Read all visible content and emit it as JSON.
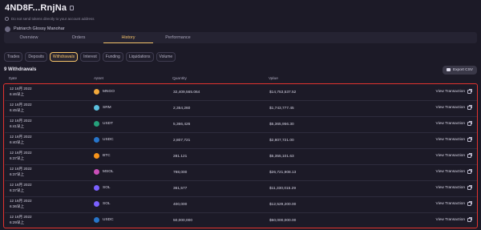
{
  "header": {
    "title": "4ND8F...RnjNa",
    "warning": "Do not send tokens directly to your account address",
    "profile_name": "Patriarch Glossy Manohar"
  },
  "tabs": [
    {
      "label": "Overview",
      "active": false
    },
    {
      "label": "Orders",
      "active": false
    },
    {
      "label": "History",
      "active": true
    },
    {
      "label": "Performance",
      "active": false
    }
  ],
  "filters": [
    {
      "label": "Trades",
      "active": false
    },
    {
      "label": "Deposits",
      "active": false
    },
    {
      "label": "Withdrawals",
      "active": true
    },
    {
      "label": "Interest",
      "active": false
    },
    {
      "label": "Funding",
      "active": false
    },
    {
      "label": "Liquidations",
      "active": false
    },
    {
      "label": "Volume",
      "active": false
    }
  ],
  "section": {
    "title": "9 Withdrawals",
    "export_label": "Export CSV"
  },
  "columns": {
    "date": "Date",
    "asset": "Asset",
    "quantity": "Quantity",
    "value": "Value"
  },
  "rows": [
    {
      "date": "12 16月 2022",
      "time": "6:46早上",
      "asset": "MNGO",
      "coin_color": "#f2a93b",
      "quantity": "32,409,565.064",
      "value": "$14,753,537.52",
      "action": "View Transaction"
    },
    {
      "date": "12 16月 2022",
      "time": "6:45早上",
      "asset": "SRM",
      "coin_color": "#5bc0de",
      "quantity": "2,354,260",
      "value": "$1,743,777.45",
      "action": "View Transaction"
    },
    {
      "date": "12 16月 2022",
      "time": "6:41早上",
      "asset": "USDT",
      "coin_color": "#26a17b",
      "quantity": "5,366,426",
      "value": "$5,365,956.30",
      "action": "View Transaction"
    },
    {
      "date": "12 16月 2022",
      "time": "6:40早上",
      "asset": "USDC",
      "coin_color": "#2775ca",
      "quantity": "2,807,721",
      "value": "$2,807,721.00",
      "action": "View Transaction"
    },
    {
      "date": "12 16月 2022",
      "time": "6:37早上",
      "asset": "BTC",
      "coin_color": "#f7931a",
      "quantity": "281.121",
      "value": "$5,355,101.63",
      "action": "View Transaction"
    },
    {
      "date": "12 16月 2022",
      "time": "6:37早上",
      "asset": "MSOL",
      "coin_color": "#c94eb8",
      "quantity": "798,000",
      "value": "$26,721,908.13",
      "action": "View Transaction"
    },
    {
      "date": "12 16月 2022",
      "time": "6:37早上",
      "asset": "SOL",
      "coin_color": "#7b61ff",
      "quantity": "361,577",
      "value": "$11,330,015.29",
      "action": "View Transaction"
    },
    {
      "date": "12 16月 2022",
      "time": "6:36早上",
      "asset": "SOL",
      "coin_color": "#7b61ff",
      "quantity": "400,000",
      "value": "$12,529,200.00",
      "action": "View Transaction"
    },
    {
      "date": "12 16月 2022",
      "time": "6:29早上",
      "asset": "USDC",
      "coin_color": "#2775ca",
      "quantity": "50,000,000",
      "value": "$50,000,000.00",
      "action": "View Transaction"
    }
  ],
  "colors": {
    "accent": "#f4c26a",
    "highlight_border": "#e3342f",
    "background": "#1c1a27"
  }
}
